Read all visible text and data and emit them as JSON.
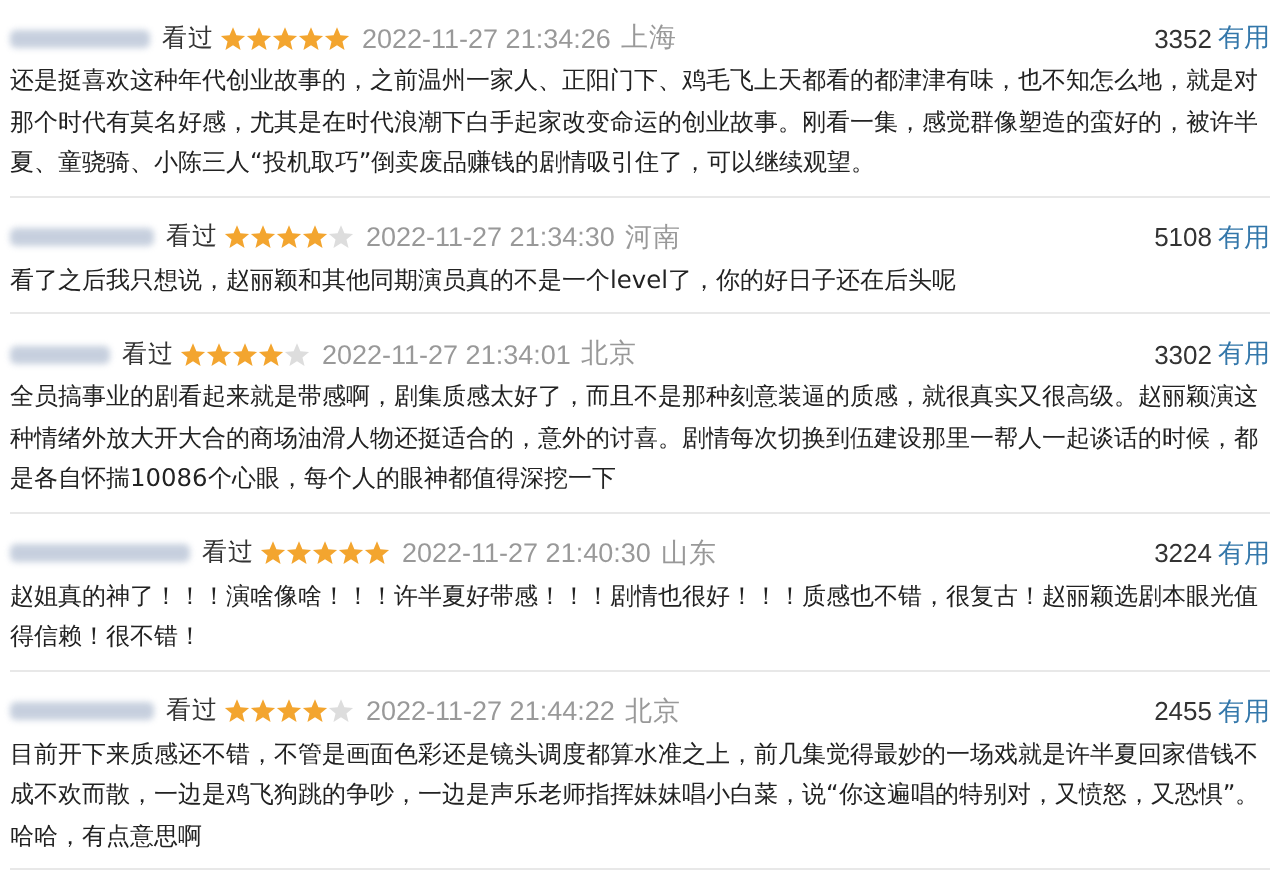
{
  "reviews": [
    {
      "status": "看过",
      "stars": 5,
      "time": "2022-11-27 21:34:26",
      "location": "上海",
      "votes": "3352",
      "useful": "有用",
      "text": "还是挺喜欢这种年代创业故事的，之前温州一家人、正阳门下、鸡毛飞上天都看的都津津有味，也不知怎么地，就是对那个时代有莫名好感，尤其是在时代浪潮下白手起家改变命运的创业故事。刚看一集，感觉群像塑造的蛮好的，被许半夏、童骁骑、小陈三人“投机取巧”倒卖废品赚钱的剧情吸引住了，可以继续观望。"
    },
    {
      "status": "看过",
      "stars": 4,
      "time": "2022-11-27 21:34:30",
      "location": "河南",
      "votes": "5108",
      "useful": "有用",
      "text": "看了之后我只想说，赵丽颖和其他同期演员真的不是一个level了，你的好日子还在后头呢"
    },
    {
      "status": "看过",
      "stars": 4,
      "time": "2022-11-27 21:34:01",
      "location": "北京",
      "votes": "3302",
      "useful": "有用",
      "text": "全员搞事业的剧看起来就是带感啊，剧集质感太好了，而且不是那种刻意装逼的质感，就很真实又很高级。赵丽颖演这种情绪外放大开大合的商场油滑人物还挺适合的，意外的讨喜。剧情每次切换到伍建设那里一帮人一起谈话的时候，都是各自怀揣10086个心眼，每个人的眼神都值得深挖一下"
    },
    {
      "status": "看过",
      "stars": 5,
      "time": "2022-11-27 21:40:30",
      "location": "山东",
      "votes": "3224",
      "useful": "有用",
      "text": "赵姐真的神了！！！演啥像啥！！！许半夏好带感！！！剧情也很好！！！质感也不错，很复古！赵丽颖选剧本眼光值得信赖！很不错！"
    },
    {
      "status": "看过",
      "stars": 4,
      "time": "2022-11-27 21:44:22",
      "location": "北京",
      "votes": "2455",
      "useful": "有用",
      "text": "目前开下来质感还不错，不管是画面色彩还是镜头调度都算水准之上，前几集觉得最妙的一场戏就是许半夏回家借钱不成不欢而散，一边是鸡飞狗跳的争吵，一边是声乐老师指挥妹妹唱小白菜，说“你这遍唱的特别对，又愤怒，又恐惧”。哈哈，有点意思啊"
    }
  ]
}
